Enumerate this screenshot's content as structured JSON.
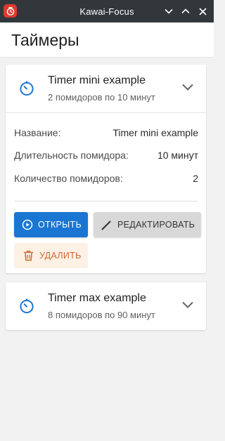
{
  "window": {
    "title": "Kawai-Focus",
    "icons": [
      "app-tomato-icon",
      "minimize-icon",
      "maximize-icon",
      "close-icon"
    ]
  },
  "page": {
    "title": "Таймеры"
  },
  "timers": [
    {
      "name": "Timer mini example",
      "subtitle": "2 помидоров по 10 минут",
      "expanded": true,
      "details": [
        {
          "label": "Название:",
          "value": "Timer mini example"
        },
        {
          "label": "Длительность помидора:",
          "value": "10 минут"
        },
        {
          "label": "Количество помидоров:",
          "value": "2"
        }
      ],
      "actions": {
        "open": "ОТКРЫТЬ",
        "edit": "РЕДАКТИРОВАТЬ",
        "delete": "УДАЛИТЬ"
      }
    },
    {
      "name": "Timer max example",
      "subtitle": "8 помидоров по 90 минут",
      "expanded": false
    }
  ],
  "colors": {
    "titlebar": "#32373c",
    "primary": "#1a76d2",
    "danger": "#d1662a",
    "danger_bg": "#fdf1e6",
    "neutral_button": "#d8d8d8"
  }
}
